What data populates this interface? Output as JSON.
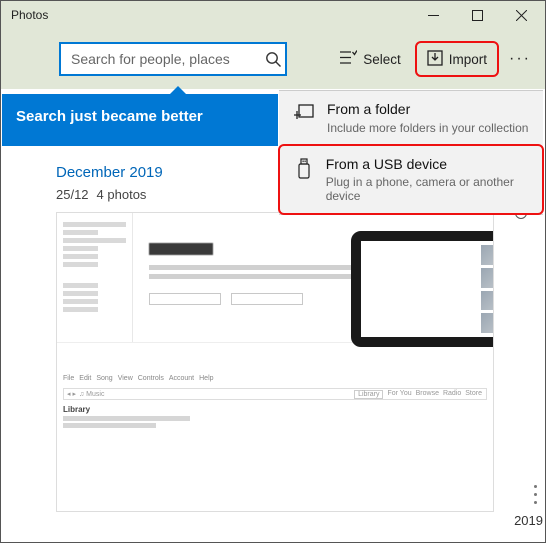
{
  "window": {
    "title": "Photos"
  },
  "toolbar": {
    "search_placeholder": "Search for people, places",
    "select_label": "Select",
    "import_label": "Import"
  },
  "tip": {
    "headline": "Search just became better"
  },
  "import_menu": {
    "items": [
      {
        "label": "From a folder",
        "sublabel": "Include more folders in your collection"
      },
      {
        "label": "From a USB device",
        "sublabel": "Plug in a phone, camera or another device"
      }
    ]
  },
  "collection": {
    "month_header": "December 2019",
    "date": "25/12",
    "count_label": "4 photos"
  },
  "timeline": {
    "year": "2019"
  }
}
